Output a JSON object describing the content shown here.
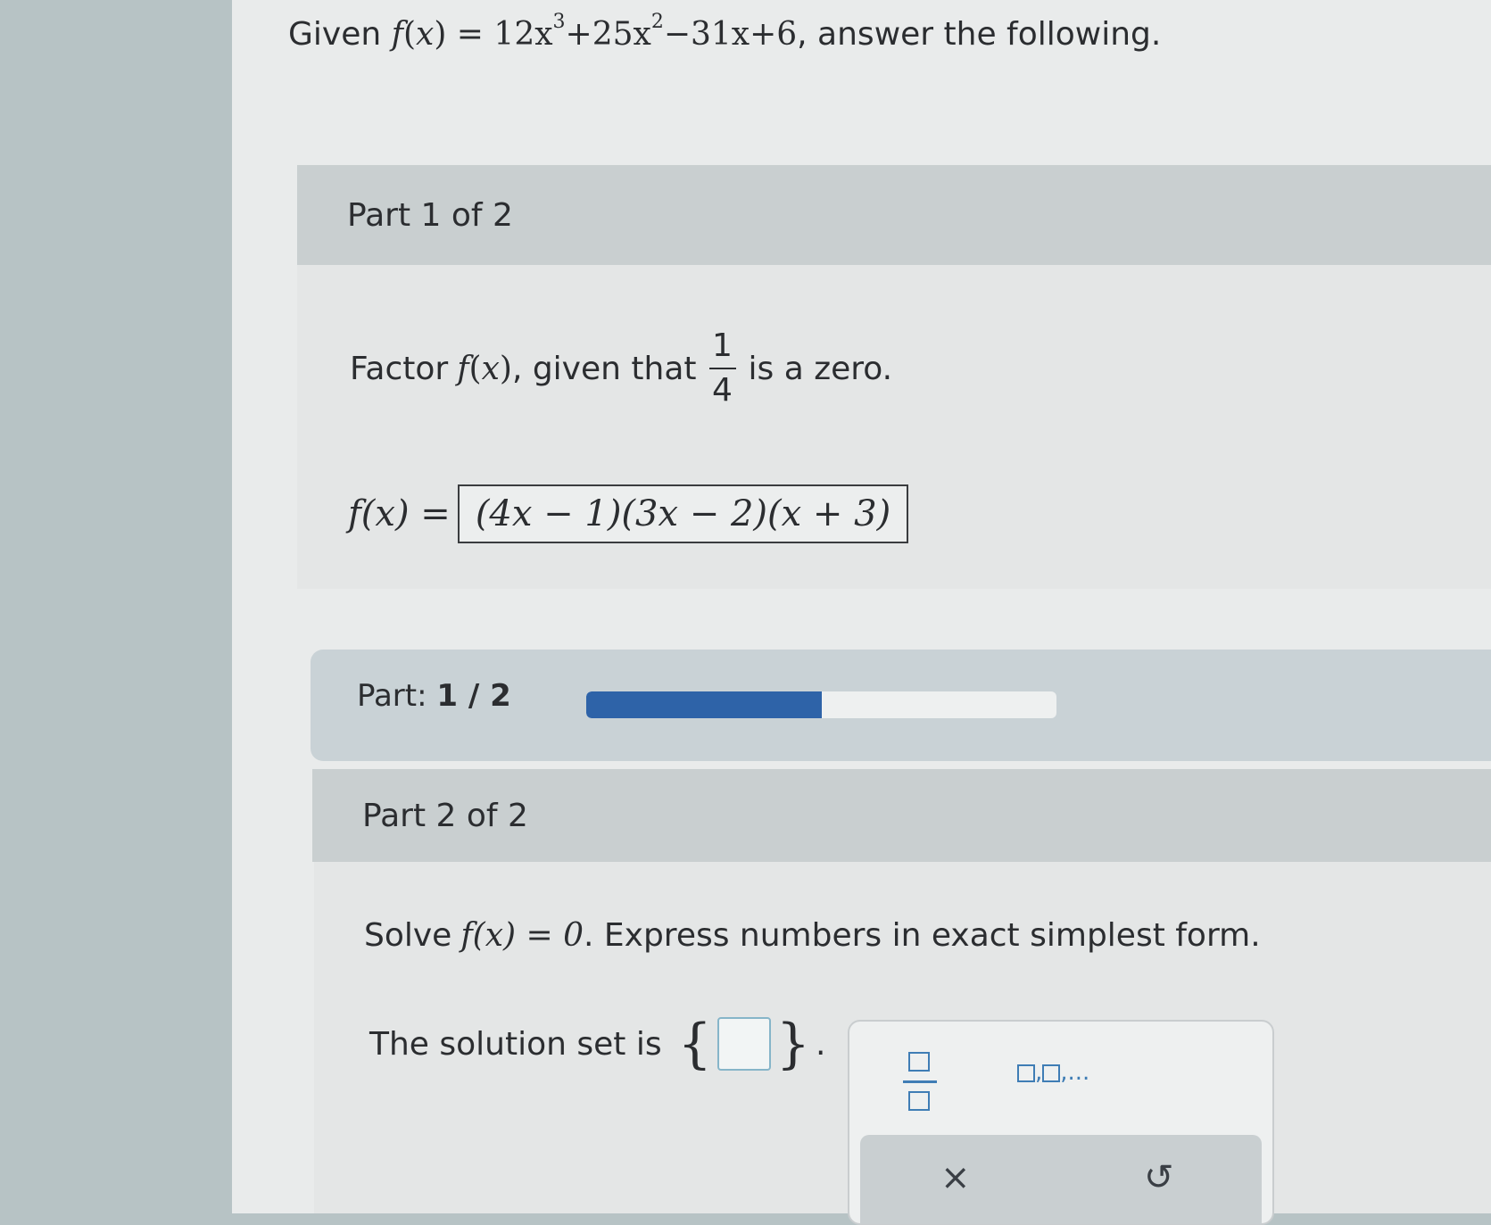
{
  "problem": {
    "prefix": "Given",
    "func": "f",
    "var": "x",
    "poly_a": "12x",
    "exp_a": "3",
    "poly_b": "+25x",
    "exp_b": "2",
    "poly_c": "−31x+6",
    "suffix": ", answer the following."
  },
  "part1": {
    "header": "Part 1 of 2",
    "prompt_prefix": "Factor",
    "prompt_mid": ", given that",
    "frac_num": "1",
    "frac_den": "4",
    "prompt_suffix": "is a zero.",
    "answer_lhs": "f(x) =",
    "answer_value": "(4x − 1)(3x − 2)(x + 3)"
  },
  "progress": {
    "label": "Part:",
    "value_text": "1 / 2",
    "fraction": 0.5
  },
  "part2": {
    "header": "Part 2 of 2",
    "prompt_prefix": "Solve",
    "prompt_eq": "f(x) = 0",
    "prompt_suffix": ". Express numbers in exact simplest form.",
    "solution_label": "The solution set is",
    "open_brace": "{",
    "close_brace": "}",
    "period": "."
  },
  "toolbox": {
    "fraction_icon": "fraction-icon",
    "list_separator": ",",
    "list_ellipsis": ",...",
    "clear_symbol": "×",
    "undo_symbol": "↺"
  },
  "colors": {
    "accent": "#2e63a8",
    "tool_blue": "#3f7db5"
  }
}
